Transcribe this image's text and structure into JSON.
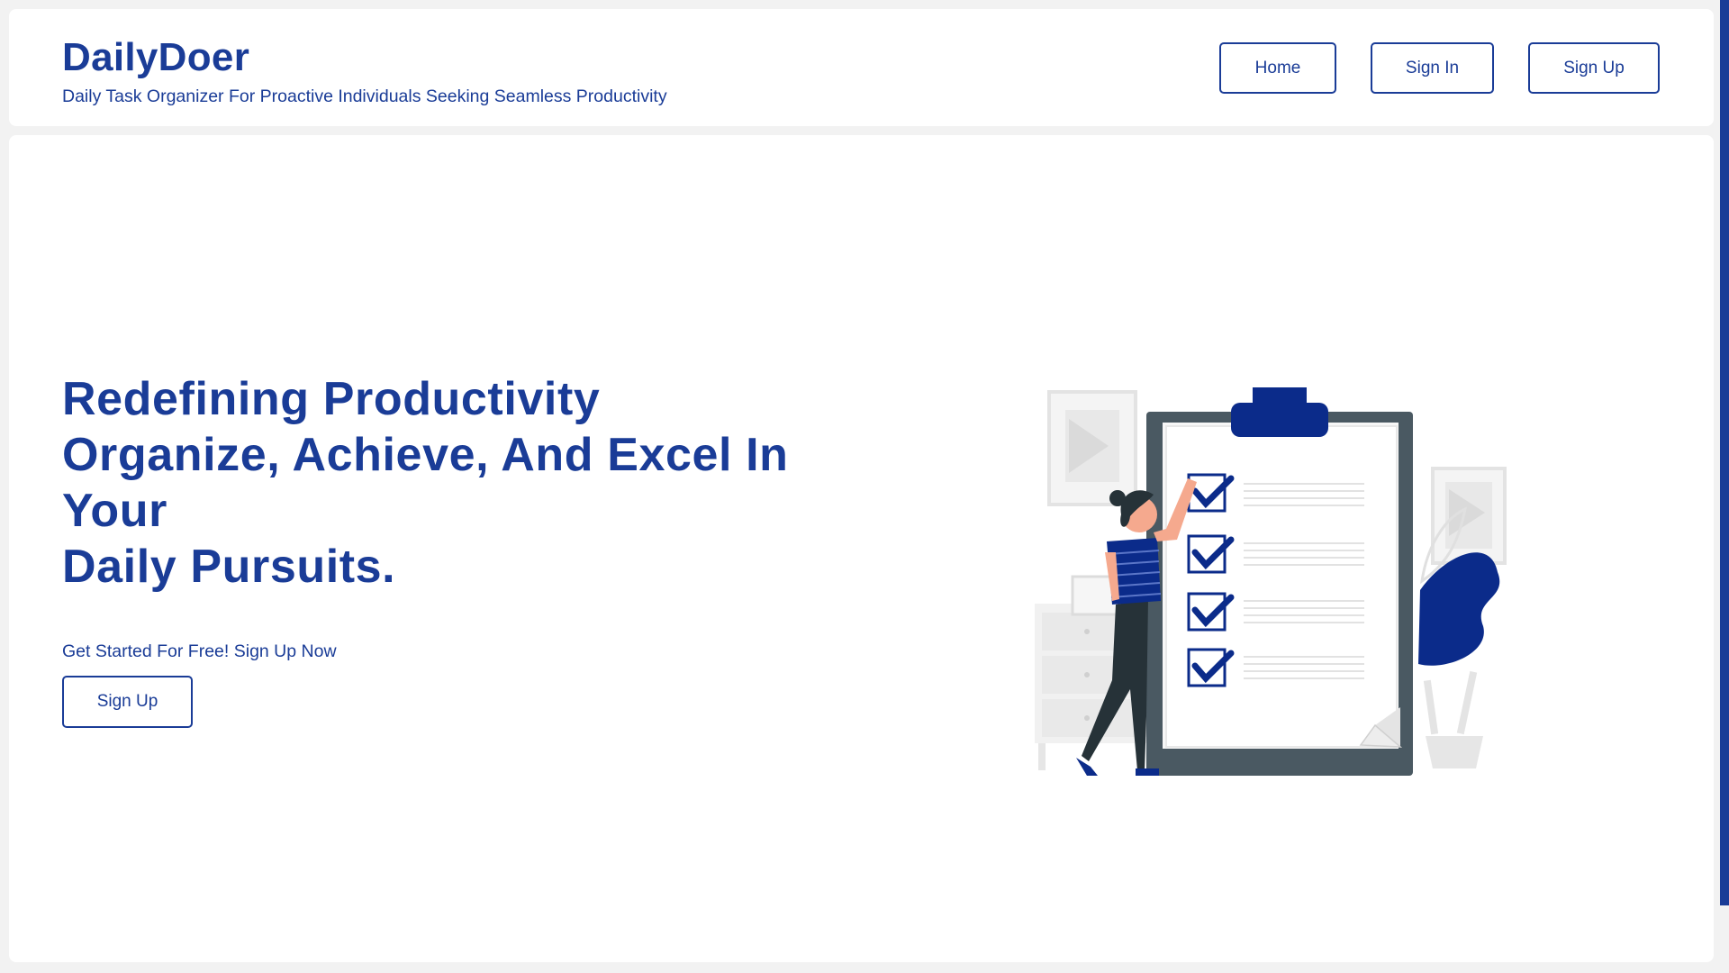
{
  "app": {
    "title": "DailyDoer",
    "tagline": "Daily Task Organizer For Proactive Individuals Seeking Seamless Productivity"
  },
  "nav": {
    "home": "Home",
    "sign_in": "Sign In",
    "sign_up": "Sign Up"
  },
  "hero": {
    "heading_lines": [
      "Redefining Productivity",
      "Organize, Achieve, And Excel In Your",
      "Daily Pursuits."
    ],
    "cta_text": "Get Started For Free! Sign Up Now",
    "cta_button": "Sign Up"
  },
  "illustration": {
    "icon": "checklist-illustration",
    "checked_items": 4
  },
  "colors": {
    "brand": "#1a3c97",
    "accent_dark": "#0b2b8a",
    "board_frame": "#4a5962",
    "background": "#f2f2f2"
  }
}
